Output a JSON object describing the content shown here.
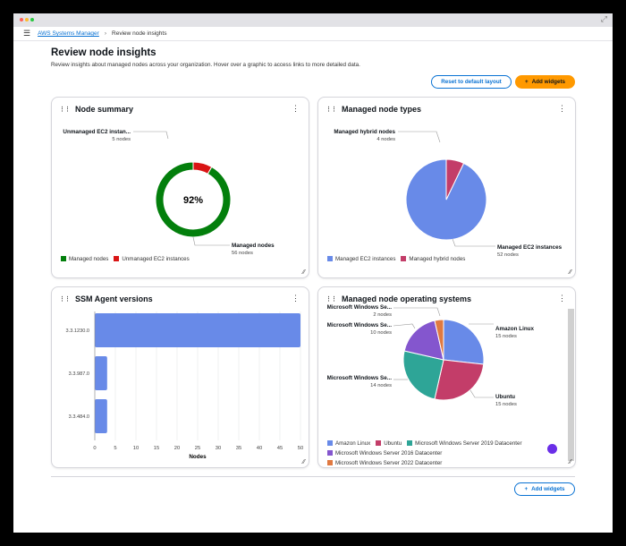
{
  "window": {
    "dots": [
      "#ff5f57",
      "#febc2e",
      "#28c840"
    ]
  },
  "breadcrumb": {
    "root": "AWS Systems Manager",
    "current": "Review node insights"
  },
  "page": {
    "title": "Review node insights",
    "description": "Review insights about managed nodes across your organization. Hover over a graphic to access links to more detailed data."
  },
  "actions": {
    "reset": "Reset to default layout",
    "add": "Add widgets",
    "add_bottom": "Add widgets"
  },
  "colors": {
    "green": "#037f0c",
    "red": "#d91515",
    "blue": "#688ae8",
    "magenta": "#c33d69",
    "teal": "#2ea597",
    "purple": "#8456ce",
    "orange": "#e07941",
    "accent": "#ff9900",
    "link": "#0972d3"
  },
  "chart_data": [
    {
      "type": "pie",
      "variant": "donut",
      "title": "Node summary",
      "center_label": "92%",
      "slices": [
        {
          "name": "Managed nodes",
          "value": 56,
          "label": "56 nodes",
          "color": "#037f0c"
        },
        {
          "name": "Unmanaged EC2 instances",
          "short": "Unmanaged EC2 instan...",
          "value": 5,
          "label": "5 nodes",
          "color": "#d91515"
        }
      ],
      "legend": "bottom"
    },
    {
      "type": "pie",
      "title": "Managed node types",
      "slices": [
        {
          "name": "Managed EC2 instances",
          "value": 52,
          "label": "52 nodes",
          "color": "#688ae8"
        },
        {
          "name": "Managed hybrid nodes",
          "value": 4,
          "label": "4 nodes",
          "color": "#c33d69"
        }
      ],
      "legend": "bottom"
    },
    {
      "type": "bar",
      "orientation": "horizontal",
      "title": "SSM Agent versions",
      "categories": [
        "3.3.1230.0",
        "3.3.987.0",
        "3.3.484.0"
      ],
      "values": [
        50,
        3,
        3
      ],
      "xlabel": "Nodes",
      "xlim": [
        0,
        50
      ],
      "xticks": [
        0,
        5,
        10,
        15,
        20,
        25,
        30,
        35,
        40,
        45,
        50
      ],
      "grid": true,
      "color": "#688ae8"
    },
    {
      "type": "pie",
      "title": "Managed node operating systems",
      "slices": [
        {
          "name": "Amazon Linux",
          "short": "Amazon Linux",
          "value": 15,
          "label": "15 nodes",
          "color": "#688ae8"
        },
        {
          "name": "Ubuntu",
          "short": "Ubuntu",
          "value": 15,
          "label": "15 nodes",
          "color": "#c33d69"
        },
        {
          "name": "Microsoft Windows Server 2019 Datacenter",
          "short": "Microsoft Windows Se...",
          "value": 14,
          "label": "14 nodes",
          "color": "#2ea597"
        },
        {
          "name": "Microsoft Windows Server 2016 Datacenter",
          "short": "Microsoft Windows Se...",
          "value": 10,
          "label": "10 nodes",
          "color": "#8456ce"
        },
        {
          "name": "Microsoft Windows Server 2022 Datacenter",
          "short": "Microsoft Windows Se...",
          "value": 2,
          "label": "2 nodes",
          "color": "#e07941"
        }
      ],
      "legend": "bottom"
    }
  ]
}
